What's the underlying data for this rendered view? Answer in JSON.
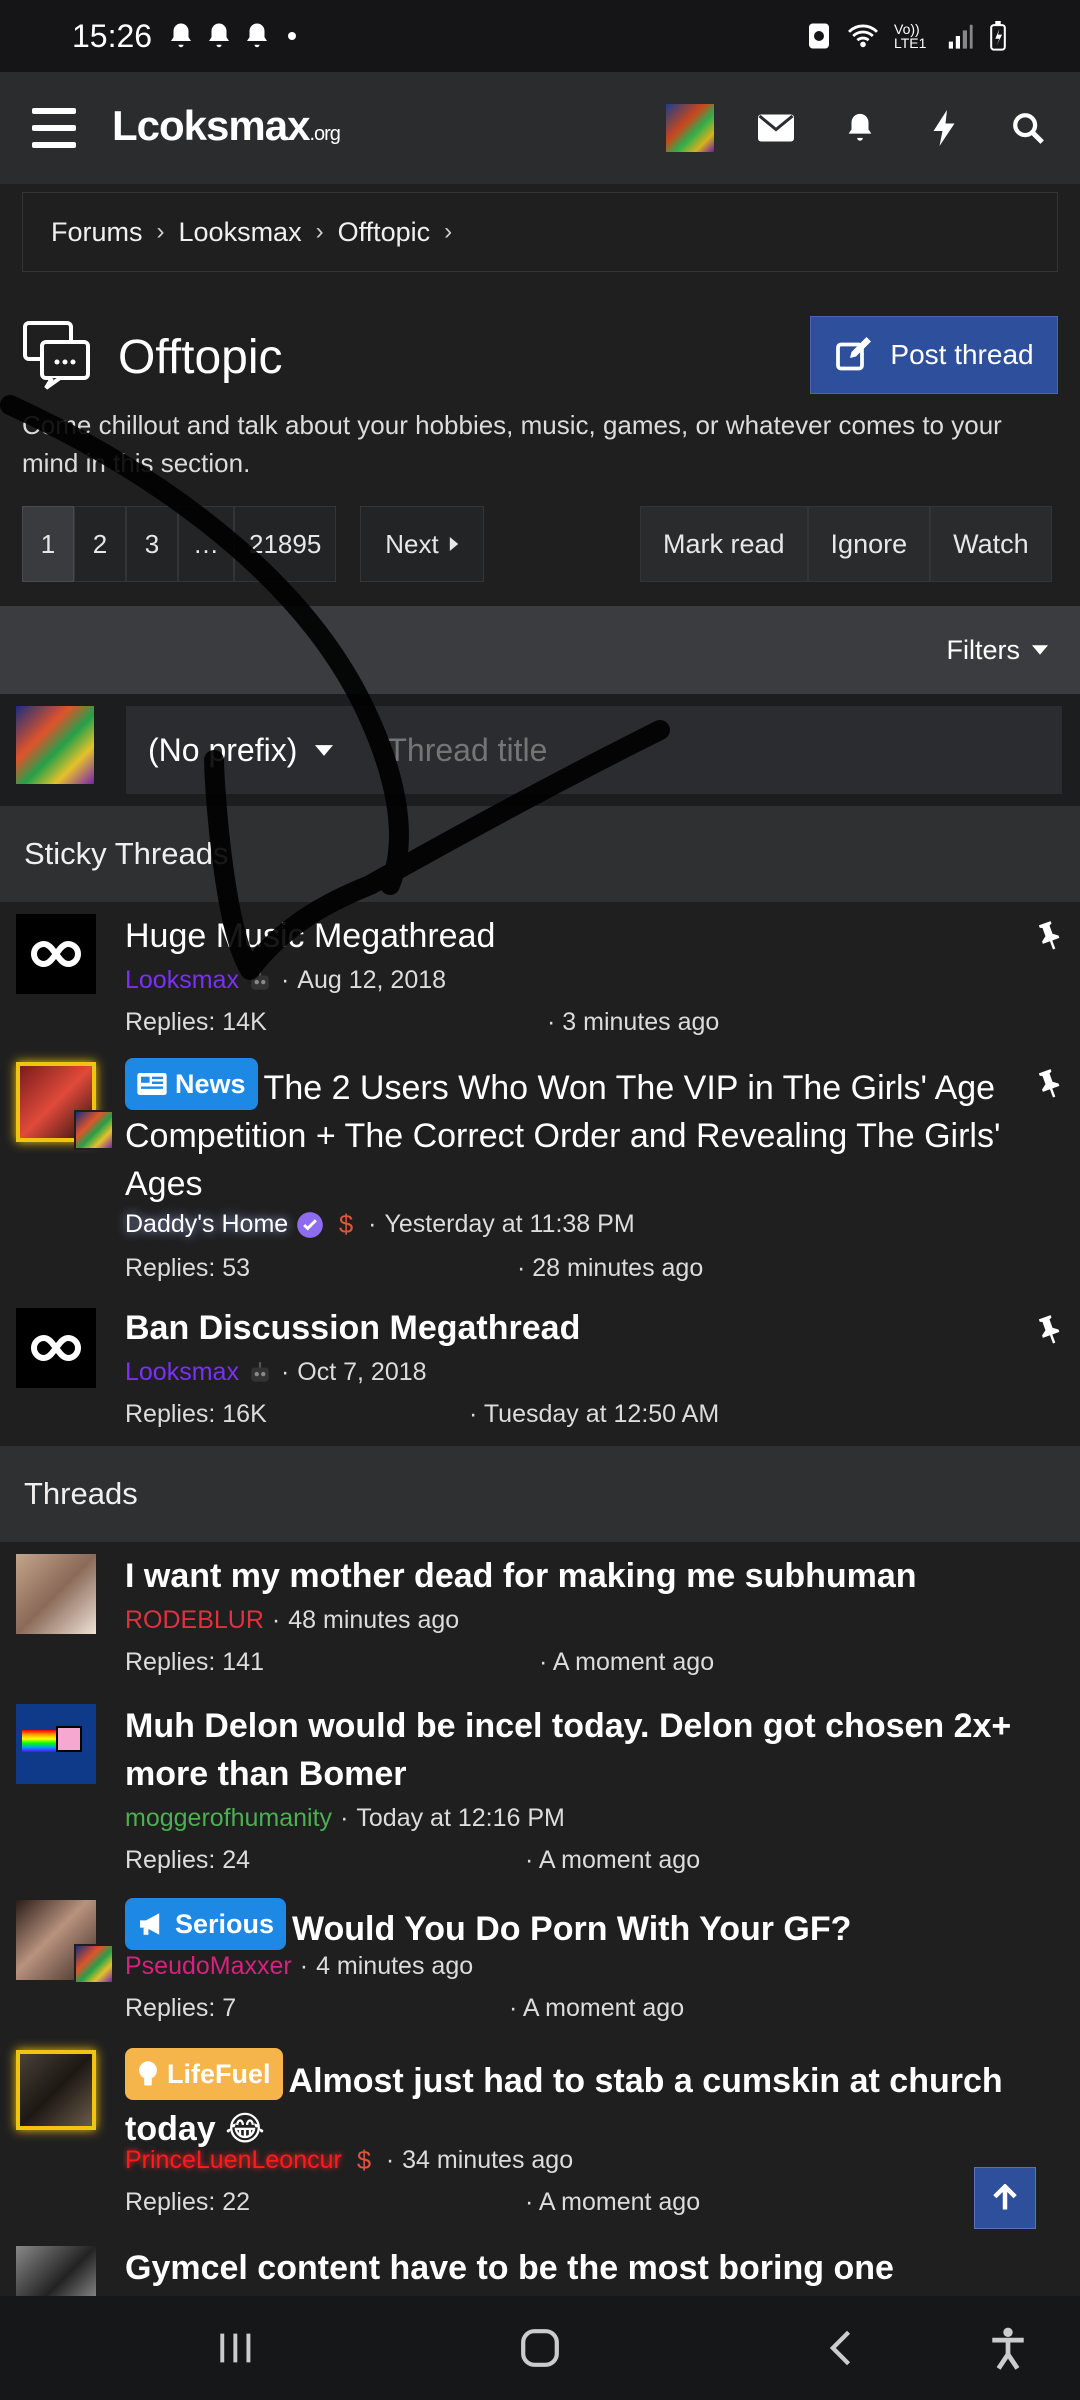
{
  "status_bar": {
    "time": "15:26",
    "icons": [
      "bell-icon",
      "bell-icon",
      "bell-icon",
      "dot-icon",
      "sim-icon",
      "wifi-icon",
      "volte-icon",
      "signal-icon",
      "battery-icon"
    ],
    "volte_label": "Vo)) LTE1"
  },
  "header": {
    "logo_text": "Lcoksmax",
    "logo_suffix": ".org",
    "icons": [
      "menu-icon",
      "avatar",
      "mail-icon",
      "bell-icon",
      "bolt-icon",
      "search-icon"
    ]
  },
  "breadcrumb": [
    "Forums",
    "Looksmax",
    "Offtopic"
  ],
  "forum": {
    "title": "Offtopic",
    "description": "Come chillout and talk about your hobbies, music, games, or whatever comes to your mind in this section.",
    "post_thread_label": "Post thread"
  },
  "pagination": {
    "pages": [
      "1",
      "2",
      "3",
      "…",
      "21895"
    ],
    "current": "1",
    "next_label": "Next"
  },
  "actions": [
    "Mark read",
    "Ignore",
    "Watch"
  ],
  "filters_label": "Filters",
  "quick_thread": {
    "prefix_label": "(No prefix)",
    "title_placeholder": "Thread title"
  },
  "sticky_header": "Sticky Threads",
  "threads_header": "Threads",
  "sticky_threads": [
    {
      "title": "Huge Music Megathread",
      "author": "Looksmax",
      "date": "Aug 12, 2018",
      "replies": "Replies: 14K",
      "last": "3 minutes ago"
    },
    {
      "prefix": "News",
      "title": "The 2 Users Who Won The VIP in The Girls' Age Competition + The Correct Order and Revealing The Girls' Ages",
      "author": "Daddy's Home",
      "date": "Yesterday at 11:38 PM",
      "replies": "Replies: 53",
      "last": "28 minutes ago"
    },
    {
      "title": "Ban Discussion Megathread",
      "author": "Looksmax",
      "date": "Oct 7, 2018",
      "replies": "Replies: 16K",
      "last": "Tuesday at 12:50 AM"
    }
  ],
  "threads": [
    {
      "title": "I want my mother dead for making me subhuman",
      "author": "RODEBLUR",
      "date": "48 minutes ago",
      "replies": "Replies: 141",
      "last": "A moment ago"
    },
    {
      "title": "Muh Delon would be incel today. Delon got chosen 2x+ more than Bomer",
      "author": "moggerofhumanity",
      "date": "Today at 12:16 PM",
      "replies": "Replies: 24",
      "last": "A moment ago"
    },
    {
      "prefix": "Serious",
      "title": "Would You Do Porn With Your GF?",
      "author": "PseudoMaxxer",
      "date": "4 minutes ago",
      "replies": "Replies: 7",
      "last": "A moment ago"
    },
    {
      "prefix": "LifeFuel",
      "title": "Almost just had to stab a cumskin at church today 😂",
      "author": "PrinceLuenLeoncur",
      "date": "34 minutes ago",
      "replies": "Replies: 22",
      "last": "A moment ago"
    },
    {
      "title": "Gymcel content have to be the most boring one"
    }
  ],
  "colors": {
    "accent": "#2e4f9c",
    "background": "#1f1f20",
    "header": "#2b2c2e",
    "news_prefix": "#1e88e5",
    "lifefuel_prefix": "#f5b54a",
    "highlight_ring": "#f1c40f"
  }
}
